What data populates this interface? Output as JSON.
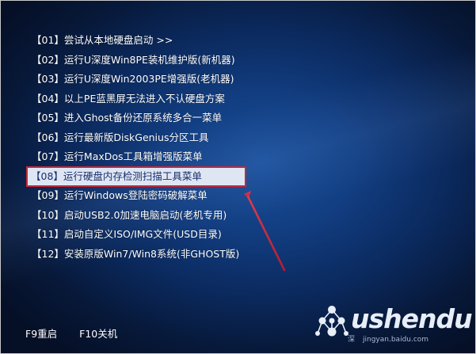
{
  "menu": {
    "items": [
      {
        "label": "【01】尝试从本地硬盘启动 >>"
      },
      {
        "label": "【02】运行U深度Win8PE装机维护版(新机器)"
      },
      {
        "label": "【03】运行U深度Win2003PE增强版(老机器)"
      },
      {
        "label": "【04】以上PE蓝黑屏无法进入不认硬盘方案"
      },
      {
        "label": "【05】进入Ghost备份还原系统多合一菜单"
      },
      {
        "label": "【06】运行最新版DiskGenius分区工具"
      },
      {
        "label": "【07】运行MaxDos工具箱增强版菜单"
      },
      {
        "label": "【08】运行硬盘内存检测扫描工具菜单",
        "selected": true
      },
      {
        "label": "【09】运行Windows登陆密码破解菜单"
      },
      {
        "label": "【10】启动USB2.0加速电脑启动(老机专用)"
      },
      {
        "label": "【11】启动自定义ISO/IMG文件(USD目录)"
      },
      {
        "label": "【12】安装原版Win7/Win8系统(非GHOST版)"
      }
    ]
  },
  "footer": {
    "f9": "F9重启",
    "f10": "F10关机"
  },
  "logo": {
    "word": "ushendu",
    "sub_left": "深",
    "sub_site": "jingyan.baidu.com"
  },
  "colors": {
    "selection_bg": "#dfe6f3",
    "selection_border": "#c4293a",
    "annotation_arrow": "#c4293a"
  }
}
